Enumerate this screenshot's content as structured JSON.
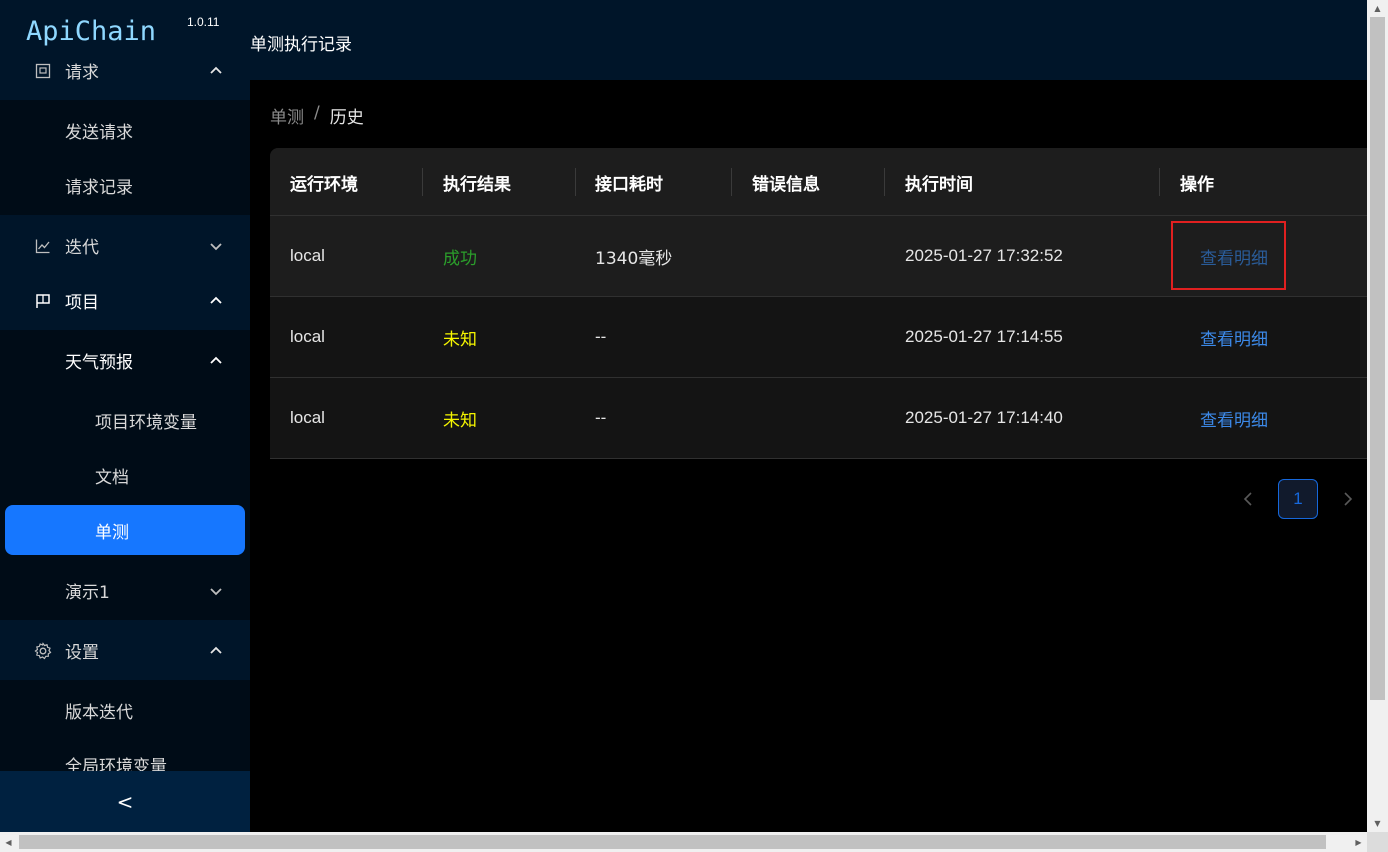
{
  "app": {
    "name": "ApiChain",
    "version": "1.0.11"
  },
  "sidebar": {
    "groups": [
      {
        "label": "请求",
        "icon": "request-icon",
        "expanded": true,
        "children": [
          "发送请求",
          "请求记录"
        ]
      },
      {
        "label": "迭代",
        "icon": "line-chart-icon",
        "expanded": false
      },
      {
        "label": "项目",
        "icon": "flag-icon",
        "expanded": true,
        "project": {
          "label": "天气预报",
          "expanded": true,
          "children": [
            "项目环境变量",
            "文档",
            "单测"
          ],
          "selected": "单测"
        },
        "other_project": {
          "label": "演示1",
          "expanded": false
        }
      },
      {
        "label": "设置",
        "icon": "gear-icon",
        "expanded": true,
        "children": [
          "版本迭代",
          "全局环境变量"
        ]
      }
    ],
    "collapse_label": "<"
  },
  "header": {
    "title": "单测执行记录"
  },
  "breadcrumb": {
    "items": [
      "单测",
      "历史"
    ],
    "separator": "/"
  },
  "table": {
    "columns": [
      "运行环境",
      "执行结果",
      "接口耗时",
      "错误信息",
      "执行时间",
      "操作"
    ],
    "rows": [
      {
        "env": "local",
        "result": "成功",
        "result_status": "success",
        "duration": "1340毫秒",
        "error": "",
        "time": "2025-01-27 17:32:52",
        "action": "查看明细"
      },
      {
        "env": "local",
        "result": "未知",
        "result_status": "unknown",
        "duration": "--",
        "error": "",
        "time": "2025-01-27 17:14:55",
        "action": "查看明细"
      },
      {
        "env": "local",
        "result": "未知",
        "result_status": "unknown",
        "duration": "--",
        "error": "",
        "time": "2025-01-27 17:14:40",
        "action": "查看明细"
      }
    ]
  },
  "pagination": {
    "current_page": "1",
    "prev": "<",
    "next": ">"
  },
  "colors": {
    "sidebar_bg": "#001529",
    "submenu_bg": "#000c17",
    "accent": "#1677ff",
    "success": "#2b9e2b",
    "unknown": "#f5f500",
    "link": "#3c89e8",
    "highlight": "#e02020"
  }
}
